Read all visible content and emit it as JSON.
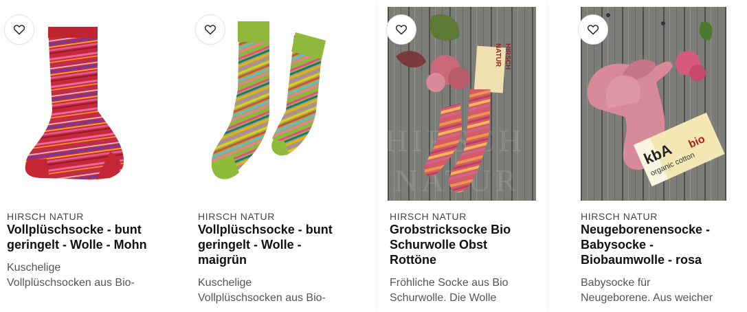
{
  "products": [
    {
      "brand": "HIRSCH NATUR",
      "title_lines": [
        "Vollplüschsocke - bunt",
        "geringelt - Wolle - Mohn"
      ],
      "desc_lines": [
        "Kuschelige",
        "Vollplüschsocken aus Bio-"
      ],
      "wishlist_icon": "heart-icon",
      "image": "sock-red-striped"
    },
    {
      "brand": "HIRSCH NATUR",
      "title_lines": [
        "Vollplüschsocke - bunt",
        "geringelt - Wolle -",
        "maigrün"
      ],
      "desc_lines": [
        "Kuschelige",
        "Vollplüschsocken aus Bio-"
      ],
      "wishlist_icon": "heart-icon",
      "image": "sock-green-striped"
    },
    {
      "brand": "HIRSCH NATUR",
      "title_lines": [
        "Grobstricksocke Bio",
        "Schurwolle Obst",
        "Rottöne"
      ],
      "desc_lines": [
        "Fröhliche Socke aus Bio",
        "Schurwolle. Die Wolle"
      ],
      "wishlist_icon": "heart-icon",
      "image": "socks-on-wood",
      "tag_text": [
        "HIRSCH",
        "NATUR"
      ]
    },
    {
      "brand": "HIRSCH NATUR",
      "title_lines": [
        "Neugeborenensocke -",
        "Babysocke -",
        "Biobaumwolle - rosa"
      ],
      "desc_lines": [
        "Babysocke für",
        "Neugeborene. Aus weicher"
      ],
      "wishlist_icon": "heart-icon",
      "image": "baby-socks-on-wood",
      "tag_text": [
        "kbA",
        "organic cotton",
        "bio"
      ]
    }
  ]
}
